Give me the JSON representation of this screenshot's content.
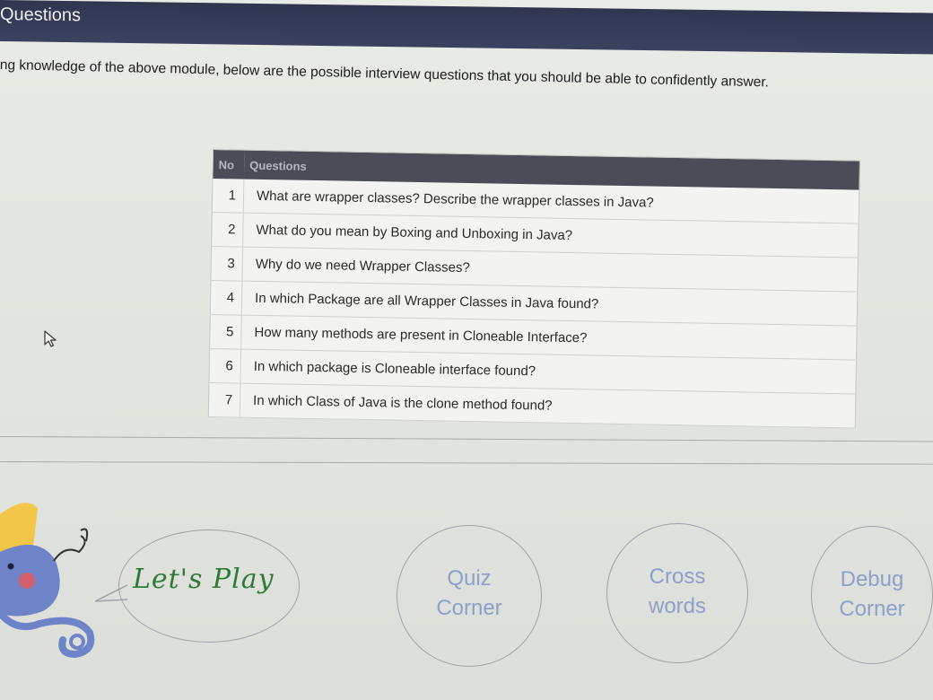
{
  "header": {
    "title": "Questions"
  },
  "intro": {
    "text": "ng knowledge of the above module, below are the possible interview questions that you should be able to confidently answer."
  },
  "table": {
    "headers": [
      "No",
      "Questions"
    ],
    "rows": [
      {
        "no": "1",
        "question": "What are wrapper classes? Describe the wrapper classes in Java?"
      },
      {
        "no": "2",
        "question": "What do you mean by Boxing and Unboxing in Java?"
      },
      {
        "no": "3",
        "question": "Why do we need Wrapper Classes?"
      },
      {
        "no": "4",
        "question": "In which Package are all Wrapper Classes in Java found?"
      },
      {
        "no": "5",
        "question": "How many methods are present in Cloneable Interface?"
      },
      {
        "no": "6",
        "question": "In which package is Cloneable interface found?"
      },
      {
        "no": "7",
        "question": "In which Class of Java is the clone method found?"
      }
    ]
  },
  "activities": {
    "lets_play": "Let's Play",
    "quiz": {
      "line1": "Quiz",
      "line2": "Corner"
    },
    "cross": {
      "line1": "Cross",
      "line2": "words"
    },
    "debug": {
      "line1": "Debug",
      "line2": "Corner"
    }
  },
  "colors": {
    "header_bg": "#30364f",
    "table_header_bg": "#4a4d57",
    "lets_play_text": "#2d7a36",
    "circle_text": "#8d9fca"
  },
  "icons": [
    "mouse-cursor-icon",
    "mascot-character-icon"
  ]
}
